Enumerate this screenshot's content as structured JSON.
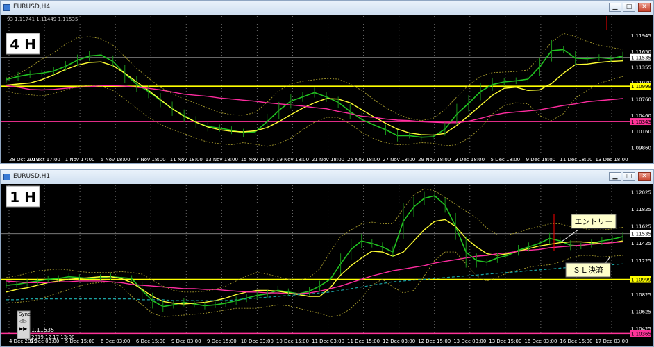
{
  "chart_data": [
    {
      "type": "line",
      "window_title": "EURUSD,H4",
      "timeframe_label": "4 H",
      "ohlc_header": "93 1.11741 1.11449 1.11535",
      "price_ticks": [
        "1.11945",
        "1.11650",
        "1.11535",
        "1.11355",
        "1.11070",
        "1.10999",
        "1.10760",
        "1.10460",
        "1.10343",
        "1.10160",
        "1.09860"
      ],
      "price_tick_values": [
        1.11945,
        1.1165,
        1.11535,
        1.11355,
        1.1107,
        1.10999,
        1.1076,
        1.1046,
        1.10343,
        1.1016,
        1.0986
      ],
      "ylim": [
        1.0975,
        1.1215
      ],
      "time_ticks": [
        "28 Oct 2019",
        "30 Oct 17:00",
        "1 Nov 17:00",
        "5 Nov 18:00",
        "7 Nov 18:00",
        "11 Nov 18:00",
        "13 Nov 18:00",
        "15 Nov 18:00",
        "19 Nov 18:00",
        "21 Nov 18:00",
        "25 Nov 18:00",
        "27 Nov 18:00",
        "29 Nov 18:00",
        "3 Dec 18:00",
        "5 Dec 18:00",
        "9 Dec 18:00",
        "11 Dec 18:00",
        "13 Dec 18:00"
      ],
      "current_price": 1.11535,
      "horizontal_levels": [
        {
          "label": "1.10999",
          "value": 1.10999,
          "color": "#ffff00"
        },
        {
          "label": "1.10343",
          "value": 1.10343,
          "color": "#ff3399"
        }
      ],
      "series": [
        {
          "role": "price",
          "values": [
            1.1112,
            1.1118,
            1.1122,
            1.1124,
            1.1128,
            1.1137,
            1.1148,
            1.1156,
            1.1158,
            1.1146,
            1.1123,
            1.1104,
            1.109,
            1.1074,
            1.1058,
            1.1045,
            1.1033,
            1.1025,
            1.1022,
            1.1018,
            1.1013,
            1.1015,
            1.1034,
            1.1055,
            1.1072,
            1.108,
            1.1088,
            1.108,
            1.107,
            1.1053,
            1.1038,
            1.1028,
            1.1019,
            1.1008,
            1.1008,
            1.1005,
            1.1006,
            1.102,
            1.1048,
            1.1068,
            1.109,
            1.1103,
            1.1108,
            1.111,
            1.1113,
            1.1136,
            1.1166,
            1.1168,
            1.1152,
            1.1151,
            1.1153,
            1.1151,
            1.1156
          ]
        },
        {
          "role": "ma_yellow",
          "values": [
            1.1102,
            1.1104,
            1.1106,
            1.1112,
            1.1121,
            1.1131,
            1.1139,
            1.1144,
            1.1145,
            1.1138,
            1.1124,
            1.1108,
            1.1092,
            1.1075,
            1.1058,
            1.1044,
            1.1033,
            1.1024,
            1.1019,
            1.1016,
            1.1015,
            1.1017,
            1.1023,
            1.1034,
            1.1047,
            1.1059,
            1.1069,
            1.1077,
            1.1076,
            1.1069,
            1.1056,
            1.1043,
            1.1031,
            1.102,
            1.1013,
            1.101,
            1.1009,
            1.1012,
            1.1027,
            1.1045,
            1.1064,
            1.1083,
            1.1096,
            1.1098,
            1.1092,
            1.1093,
            1.1105,
            1.1124,
            1.114,
            1.1141,
            1.1144,
            1.1146,
            1.1147
          ]
        },
        {
          "role": "ma_magenta",
          "values": [
            1.1101,
            1.1098,
            1.1094,
            1.1093,
            1.1094,
            1.1096,
            1.1098,
            1.1099,
            1.1101,
            1.1101,
            1.11,
            1.1098,
            1.1096,
            1.1093,
            1.1089,
            1.1085,
            1.1083,
            1.1081,
            1.1078,
            1.1076,
            1.1074,
            1.1072,
            1.1069,
            1.1067,
            1.1065,
            1.1063,
            1.106,
            1.1058,
            1.1053,
            1.1049,
            1.1044,
            1.1042,
            1.1039,
            1.1037,
            1.1036,
            1.1034,
            1.1033,
            1.1032,
            1.1032,
            1.1035,
            1.104,
            1.1046,
            1.105,
            1.1052,
            1.1054,
            1.1056,
            1.106,
            1.1064,
            1.1067,
            1.1071,
            1.1073,
            1.1075,
            1.1077
          ]
        },
        {
          "role": "band_upper",
          "values": [
            1.1114,
            1.1122,
            1.1135,
            1.115,
            1.1162,
            1.1178,
            1.119,
            1.1192,
            1.1188,
            1.1176,
            1.1155,
            1.1133,
            1.1115,
            1.1098,
            1.1086,
            1.1076,
            1.1068,
            1.1059,
            1.1051,
            1.1047,
            1.1046,
            1.1051,
            1.107,
            1.1092,
            1.1104,
            1.1109,
            1.1112,
            1.1114,
            1.1113,
            1.1104,
            1.1092,
            1.1075,
            1.106,
            1.1048,
            1.104,
            1.1036,
            1.104,
            1.1056,
            1.108,
            1.1102,
            1.1118,
            1.1125,
            1.1126,
            1.1127,
            1.113,
            1.1155,
            1.1182,
            1.1198,
            1.1192,
            1.1183,
            1.1176,
            1.1172,
            1.1168
          ]
        },
        {
          "role": "band_lower",
          "values": [
            1.109,
            1.1086,
            1.1084,
            1.1082,
            1.1086,
            1.1093,
            1.1099,
            1.1102,
            1.11,
            1.1092,
            1.1076,
            1.1059,
            1.1042,
            1.1029,
            1.1019,
            1.1012,
            1.1003,
            1.0996,
            1.0993,
            1.0991,
            1.0995,
            1.0992,
            1.0988,
            1.0993,
            1.1003,
            1.1019,
            1.1033,
            1.1042,
            1.1042,
            1.103,
            1.1014,
            1.1002,
            1.0995,
            1.0991,
            1.0992,
            1.0995,
            1.0994,
            1.0989,
            1.0991,
            1.1003,
            1.1022,
            1.1048,
            1.1064,
            1.1069,
            1.1067,
            1.1045,
            1.1036,
            1.1049,
            1.1078,
            1.1092,
            1.1105,
            1.1112,
            1.1118
          ]
        }
      ]
    },
    {
      "type": "line",
      "window_title": "EURUSD,H1",
      "timeframe_label": "1 H",
      "price_ticks": [
        "1.12025",
        "1.11825",
        "1.11625",
        "1.11535",
        "1.11425",
        "1.11225",
        "1.11025",
        "1.10999",
        "1.10825",
        "1.10625",
        "1.10425",
        "1.10365"
      ],
      "price_tick_values": [
        1.12025,
        1.11825,
        1.11625,
        1.11535,
        1.11425,
        1.11225,
        1.11025,
        1.10999,
        1.10825,
        1.10625,
        1.10425,
        1.10365
      ],
      "ylim": [
        1.1036,
        1.1207
      ],
      "time_ticks": [
        "4 Dec 2019",
        "5 Dec 03:00",
        "5 Dec 15:00",
        "6 Dec 03:00",
        "6 Dec 15:00",
        "9 Dec 03:00",
        "9 Dec 15:00",
        "10 Dec 03:00",
        "10 Dec 15:00",
        "11 Dec 03:00",
        "11 Dec 15:00",
        "12 Dec 03:00",
        "12 Dec 15:00",
        "13 Dec 03:00",
        "13 Dec 15:00",
        "16 Dec 03:00",
        "16 Dec 15:00",
        "17 Dec 03:00"
      ],
      "current_price": 1.11535,
      "horizontal_levels": [
        {
          "label": "1.10999",
          "value": 1.10999,
          "color": "#ffff00"
        },
        {
          "label": "1.10365",
          "value": 1.10365,
          "color": "#ff3399"
        }
      ],
      "series": [
        {
          "role": "price",
          "values": [
            1.1093,
            1.1094,
            1.1096,
            1.1098,
            1.11,
            1.1101,
            1.1103,
            1.1102,
            1.1101,
            1.1102,
            1.1103,
            1.1102,
            1.1101,
            1.1087,
            1.1075,
            1.1068,
            1.107,
            1.1073,
            1.1071,
            1.1069,
            1.107,
            1.1072,
            1.1075,
            1.1078,
            1.1081,
            1.1083,
            1.1087,
            1.1085,
            1.1083,
            1.1086,
            1.1092,
            1.11,
            1.1118,
            1.1135,
            1.1145,
            1.1142,
            1.1138,
            1.1132,
            1.1168,
            1.1185,
            1.1195,
            1.1198,
            1.1187,
            1.1162,
            1.1132,
            1.1122,
            1.112,
            1.1125,
            1.1128,
            1.1134,
            1.1138,
            1.1142,
            1.1148,
            1.1145,
            1.114,
            1.1139,
            1.1142,
            1.1145,
            1.1147,
            1.115
          ]
        },
        {
          "role": "ma_yellow",
          "values": [
            1.1085,
            1.1088,
            1.109,
            1.1093,
            1.1096,
            1.1098,
            1.11,
            1.1101,
            1.1102,
            1.1103,
            1.1103,
            1.1101,
            1.1096,
            1.1088,
            1.108,
            1.1074,
            1.1072,
            1.1071,
            1.1072,
            1.1073,
            1.1075,
            1.1078,
            1.1082,
            1.1085,
            1.1087,
            1.1087,
            1.1086,
            1.1084,
            1.1082,
            1.108,
            1.108,
            1.109,
            1.1105,
            1.1116,
            1.1125,
            1.1133,
            1.1132,
            1.1127,
            1.1132,
            1.1145,
            1.1158,
            1.1168,
            1.117,
            1.1162,
            1.1148,
            1.1138,
            1.113,
            1.1128,
            1.113,
            1.1133,
            1.1136,
            1.1139,
            1.1141,
            1.1143,
            1.1144,
            1.1144,
            1.1143,
            1.1142,
            1.1143,
            1.1145
          ]
        },
        {
          "role": "ma_magenta",
          "values": [
            1.1098,
            1.1097,
            1.1096,
            1.1096,
            1.1096,
            1.1097,
            1.1097,
            1.1098,
            1.1098,
            1.1098,
            1.1097,
            1.1096,
            1.1094,
            1.1093,
            1.1092,
            1.1091,
            1.109,
            1.1089,
            1.1089,
            1.1088,
            1.1088,
            1.1087,
            1.1086,
            1.1085,
            1.1085,
            1.1084,
            1.1084,
            1.1083,
            1.1083,
            1.1084,
            1.1086,
            1.1089,
            1.1092,
            1.1096,
            1.11,
            1.1104,
            1.1107,
            1.111,
            1.1112,
            1.1114,
            1.1116,
            1.1119,
            1.1121,
            1.1123,
            1.1125,
            1.1127,
            1.1128,
            1.113,
            1.1131,
            1.1133,
            1.1134,
            1.1135,
            1.1137,
            1.1138,
            1.1139,
            1.114,
            1.1141,
            1.1142,
            1.1143,
            1.1144
          ]
        },
        {
          "role": "ma_teal",
          "values": [
            1.1076,
            1.1076,
            1.1077,
            1.1077,
            1.1077,
            1.1077,
            1.1077,
            1.1077,
            1.1077,
            1.1077,
            1.1077,
            1.1077,
            1.1077,
            1.1076,
            1.1076,
            1.1076,
            1.1075,
            1.1075,
            1.1075,
            1.1075,
            1.1075,
            1.1075,
            1.1076,
            1.1077,
            1.1078,
            1.1079,
            1.108,
            1.1081,
            1.1082,
            1.1083,
            1.1084,
            1.1085,
            1.1087,
            1.1089,
            1.1091,
            1.1093,
            1.1095,
            1.1097,
            1.1098,
            1.1099,
            1.11,
            1.1101,
            1.1102,
            1.1103,
            1.1104,
            1.1105,
            1.1106,
            1.1107,
            1.1108,
            1.1109,
            1.111,
            1.1111,
            1.1112,
            1.1113,
            1.1114,
            1.1114,
            1.1115,
            1.1116,
            1.1117,
            1.1118
          ]
        },
        {
          "role": "band_upper",
          "values": [
            1.1102,
            1.1104,
            1.1107,
            1.111,
            1.1111,
            1.1112,
            1.1111,
            1.1109,
            1.1108,
            1.1108,
            1.1108,
            1.1109,
            1.1108,
            1.1106,
            1.1099,
            1.1092,
            1.1087,
            1.1085,
            1.1085,
            1.1086,
            1.1088,
            1.1092,
            1.1098,
            1.1104,
            1.1108,
            1.1106,
            1.1103,
            1.11,
            1.1099,
            1.1102,
            1.1112,
            1.1132,
            1.115,
            1.1158,
            1.1165,
            1.1167,
            1.1165,
            1.1165,
            1.1183,
            1.1199,
            1.1206,
            1.1204,
            1.1196,
            1.1188,
            1.118,
            1.1172,
            1.116,
            1.1152,
            1.1152,
            1.1155,
            1.1159,
            1.1162,
            1.1165,
            1.1165,
            1.1162,
            1.116,
            1.1158,
            1.1158,
            1.1159,
            1.1161
          ]
        },
        {
          "role": "band_lower",
          "values": [
            1.1072,
            1.1073,
            1.1074,
            1.1076,
            1.108,
            1.1084,
            1.1088,
            1.1092,
            1.1095,
            1.1096,
            1.1097,
            1.1092,
            1.108,
            1.107,
            1.106,
            1.1056,
            1.1057,
            1.1058,
            1.1059,
            1.106,
            1.1062,
            1.1064,
            1.1066,
            1.1066,
            1.1066,
            1.1068,
            1.107,
            1.1069,
            1.1066,
            1.1063,
            1.106,
            1.1056,
            1.1058,
            1.1066,
            1.1078,
            1.1093,
            1.11,
            1.1091,
            1.1084,
            1.1087,
            1.1104,
            1.1122,
            1.1132,
            1.1132,
            1.1118,
            1.1104,
            1.1098,
            1.1102,
            1.1108,
            1.1111,
            1.1114,
            1.1116,
            1.1117,
            1.112,
            1.1125,
            1.1128,
            1.1128,
            1.1126,
            1.1127,
            1.1128
          ]
        }
      ],
      "annotations": {
        "entry_label": "エントリー",
        "sl_label": "ＳＬ決済"
      },
      "sync_panel": {
        "title": "Sync",
        "price": "1.11535",
        "datetime": "2019.12.17 13:00"
      }
    }
  ]
}
